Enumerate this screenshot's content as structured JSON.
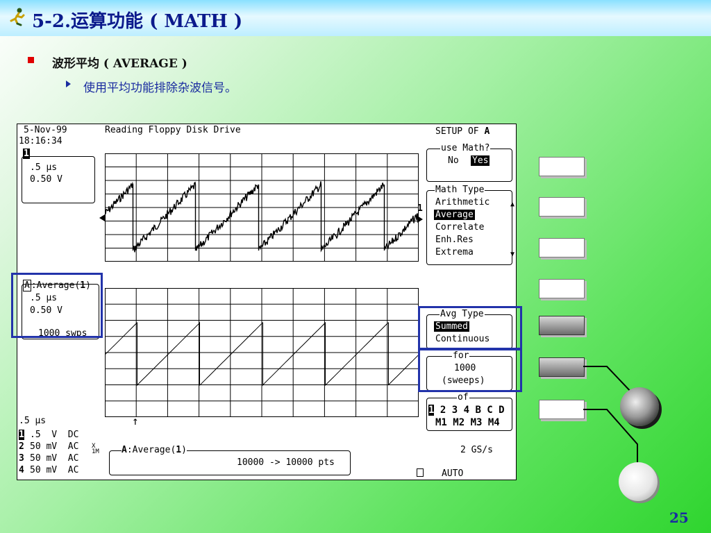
{
  "slide": {
    "title": "5-2.运算功能 ( MATH )",
    "bullet": "波形平均 ( AVERAGE )",
    "sub_bullet": "使用平均功能排除杂波信号。",
    "page_number": "25"
  },
  "scope": {
    "date": "5-Nov-99",
    "time": "18:16:34",
    "title": "Reading Floppy Disk Drive",
    "ch1_box": {
      "label": "1",
      "timebase": ".5 μs",
      "volts": "0.50 V"
    },
    "math_box": {
      "label": "A",
      "func": ":Average(",
      "src": "1",
      "close": ")",
      "timebase": ".5 μs",
      "volts": "0.50 V",
      "sweeps": "1000 swps"
    },
    "marker_1": "1",
    "bottom_timebase": ".5 μs",
    "trig_arrow": "↑",
    "channels": [
      {
        "num": "1",
        "value": ".5  V  DC"
      },
      {
        "num": "2",
        "value": "50 mV  AC"
      },
      {
        "num": "3",
        "value": "50 mV  AC"
      },
      {
        "num": "4",
        "value": "50 mV  AC"
      }
    ],
    "bw_mark": "X\n1M",
    "bottom_box": {
      "label": "A",
      "func": ":Average(",
      "src": "1",
      "close": ")",
      "pts": "10000 -> 10000 pts"
    },
    "sample_rate": "2 GS/s",
    "trig_mode": "AUTO",
    "menu": {
      "header_prefix": "SETUP OF ",
      "header_target": "A",
      "use_math": {
        "title": "use Math?",
        "no": "No",
        "yes": "Yes"
      },
      "math_type": {
        "title": "Math Type",
        "items": [
          "Arithmetic",
          "Average",
          "Correlate",
          "Enh.Res",
          "Extrema"
        ]
      },
      "avg_type": {
        "title": "Avg Type",
        "items": [
          "Summed",
          "Continuous"
        ]
      },
      "for": {
        "title": "for",
        "value": "1000",
        "unit": "(sweeps)"
      },
      "of": {
        "title": "of",
        "row1_sel": "1",
        "row1_rest": "2 3 4 B C D",
        "row2": "M1 M2 M3 M4"
      }
    }
  },
  "colors": {
    "title": "#0b1a8c",
    "highlight": "#2233aa",
    "bullet": "#e00000"
  }
}
